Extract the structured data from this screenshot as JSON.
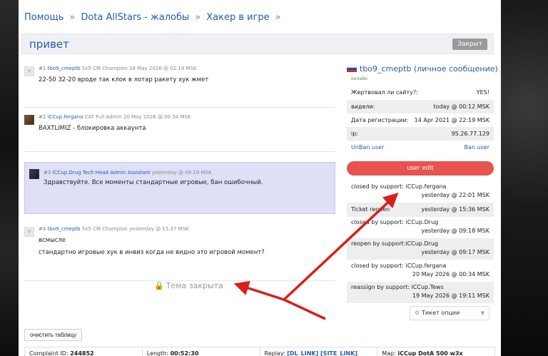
{
  "breadcrumb": [
    "Помощь",
    "Dota AllStars - жалобы",
    "Хакер в игре"
  ],
  "breadcrumb_sep": "»",
  "topic": {
    "title": "привет",
    "status_badge": "Закрыт"
  },
  "posts": [
    {
      "num": "#1",
      "author": "tbo9_cmeptb",
      "rank": "5x5 CM Champion",
      "date": "18 May 2026 @ 02:19 MSK",
      "lines": [
        "22-50 32-20 вроде так клок в лотар ракету хук жмет"
      ]
    },
    {
      "num": "#2",
      "author": "iCCup.fergana",
      "rank": "CAT Full Admin",
      "date": "20 May 2026 @ 00:34 MSK",
      "lines": [
        "BAXTLIMIZ - блокировка аккаунта"
      ]
    },
    {
      "num": "#3",
      "author": "iCCup.Drug",
      "rank": "Tech Head Admin Assistant",
      "date": "yesterday @ 09:18 MSK",
      "lines": [
        "Здравствуйте. Все моменты стандартные игровые, бан ошибочный."
      ]
    },
    {
      "num": "#4",
      "author": "tbo9_cmeptb",
      "rank": "5x5 CM Champion",
      "date": "yesterday @ 15:37 MSK",
      "lines": [
        "всмысле",
        "стандартно игровые хук в инвиз когда не видно это игровой момент?"
      ]
    }
  ],
  "closed_text": "Тема закрыта",
  "sidebar": {
    "user": "tbo9_cmeptb (личное сообщение)",
    "online": "онлайн",
    "rows": [
      {
        "label": "Жертвовал ли сайту?:",
        "value": "YES!"
      },
      {
        "label": "видели:",
        "value": "today @ 00:12 MSK"
      },
      {
        "label": "Дата регистрации:",
        "value": "14 Apr 2021 @ 22:19 MSK"
      },
      {
        "label": "ip:",
        "value": "95.26.77.129"
      }
    ],
    "unban": "UnBan user",
    "ban": "Ban user",
    "user_edit": "user edit",
    "log": [
      {
        "a": "closed by support: iCCup.fergana",
        "b": "yesterday @ 22:01 MSK"
      },
      {
        "a": "Ticket reopen",
        "b": "yesterday @ 15:36 MSK"
      },
      {
        "a": "closed by support: iCCup.Drug",
        "b": "yesterday @ 09:18 MSK"
      },
      {
        "a": "reopen by support:iCCup.Drug",
        "b": "yesterday @ 09:17 MSK"
      },
      {
        "a": "closed by support: iCCup.fergana",
        "b": "20 May 2026 @ 00:34 MSK"
      },
      {
        "a": "reassign by support: iCCup.Tews",
        "b": "19 May 2026 @ 19:11 MSK"
      }
    ],
    "ticket_options": "Тикет опции"
  },
  "clear_button": "очистить таблицу",
  "table": [
    {
      "label": "Complaint ID:",
      "value": "244852"
    },
    {
      "label": "Length:",
      "value": "00:52:30"
    },
    {
      "label": "Replay:",
      "value": "[DL_LINK] [SITE_LINK]"
    },
    {
      "label": "Map:",
      "value": "iCCup DotA 500 w3x"
    }
  ],
  "colors": {
    "accent": "#2a5aa8",
    "user_edit": "#e8524f",
    "highlight": "#dfe0f7",
    "arrow": "#d8201a"
  }
}
